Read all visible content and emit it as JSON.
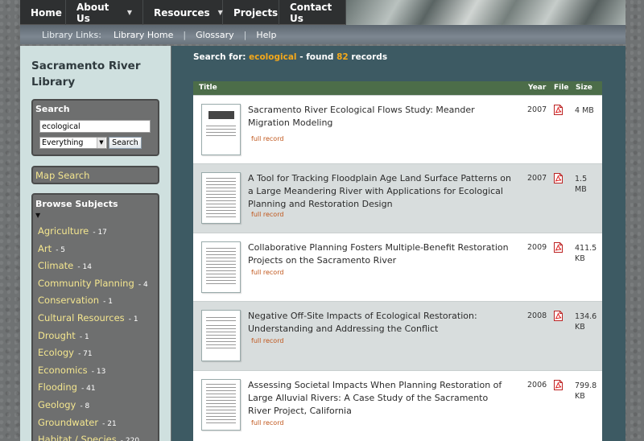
{
  "nav": {
    "home": "Home",
    "about": "About Us",
    "resources": "Resources",
    "projects": "Projects",
    "contact": "Contact Us"
  },
  "library_links": {
    "label": "Library Links:",
    "home": "Library Home",
    "glossary": "Glossary",
    "help": "Help",
    "separator": "|"
  },
  "sidebar": {
    "title": "Sacramento River Library",
    "search": {
      "heading": "Search",
      "query": "ecological",
      "scope": "Everything",
      "button": "Search"
    },
    "map_search": "Map Search",
    "subjects": {
      "heading": "Browse Subjects",
      "items": [
        {
          "name": "Agriculture",
          "count": "- 17"
        },
        {
          "name": "Art",
          "count": "- 5"
        },
        {
          "name": "Climate",
          "count": "- 14"
        },
        {
          "name": "Community Planning",
          "count": "- 4"
        },
        {
          "name": "Conservation",
          "count": "- 1"
        },
        {
          "name": "Cultural Resources",
          "count": "- 1"
        },
        {
          "name": "Drought",
          "count": "- 1"
        },
        {
          "name": "Ecology",
          "count": "- 71"
        },
        {
          "name": "Economics",
          "count": "- 13"
        },
        {
          "name": "Flooding",
          "count": "- 41"
        },
        {
          "name": "Geology",
          "count": "- 8"
        },
        {
          "name": "Groundwater",
          "count": "- 21"
        },
        {
          "name": "Habitat / Species",
          "count": "- 220"
        }
      ]
    }
  },
  "main": {
    "search_prefix": "Search for:",
    "search_term": "ecological",
    "found_prefix": "- found",
    "found_count": "82",
    "found_suffix": "records",
    "columns": {
      "title": "Title",
      "year": "Year",
      "file": "File",
      "size": "Size"
    },
    "full_record_label": "full record",
    "results": [
      {
        "title": "Sacramento River Ecological Flows Study: Meander Migration Modeling",
        "year": "2007",
        "size": "4 MB"
      },
      {
        "title": "A Tool for Tracking Floodplain Age Land Surface Patterns on a Large Meandering River with Applications for Ecological Planning and Restoration Design",
        "year": "2007",
        "size": "1.5 MB"
      },
      {
        "title": "Collaborative Planning Fosters Multiple-Benefit Restoration Projects on the Sacramento River",
        "year": "2009",
        "size": "411.5 KB"
      },
      {
        "title": "Negative Off-Site Impacts of Ecological Restoration: Understanding and Addressing the Conflict",
        "year": "2008",
        "size": "134.6 KB"
      },
      {
        "title": "Assessing Societal Impacts When Planning Restoration of Large Alluvial Rivers: A Case Study of the Sacramento River Project, California",
        "year": "2006",
        "size": "799.8 KB"
      }
    ]
  }
}
